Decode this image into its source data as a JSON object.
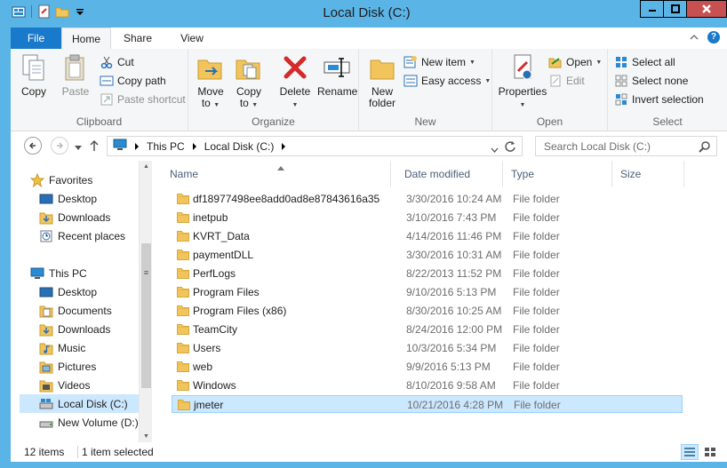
{
  "window": {
    "title": "Local Disk (C:)",
    "accent": "#5ab4e6"
  },
  "ribbon_tabs": {
    "file": "File",
    "home": "Home",
    "share": "Share",
    "view": "View"
  },
  "clipboard": {
    "label": "Clipboard",
    "copy": "Copy",
    "paste": "Paste",
    "cut": "Cut",
    "copy_path": "Copy path",
    "paste_shortcut": "Paste shortcut"
  },
  "organize": {
    "label": "Organize",
    "move_to": "Move",
    "move_to_2": "to",
    "copy_to": "Copy",
    "copy_to_2": "to",
    "delete": "Delete",
    "rename": "Rename"
  },
  "new_group": {
    "label": "New",
    "new_folder": "New",
    "new_folder_2": "folder",
    "new_item": "New item",
    "easy_access": "Easy access"
  },
  "open_group": {
    "label": "Open",
    "properties": "Properties",
    "open": "Open",
    "edit": "Edit"
  },
  "select_group": {
    "label": "Select",
    "select_all": "Select all",
    "select_none": "Select none",
    "invert_selection": "Invert selection"
  },
  "address": {
    "crumbs": [
      "This PC",
      "Local Disk (C:)"
    ],
    "search_placeholder": "Search Local Disk (C:)"
  },
  "nav": {
    "favorites": "Favorites",
    "fav_items": [
      "Desktop",
      "Downloads",
      "Recent places"
    ],
    "this_pc": "This PC",
    "pc_items": [
      "Desktop",
      "Documents",
      "Downloads",
      "Music",
      "Pictures",
      "Videos",
      "Local Disk (C:)",
      "New Volume (D:)"
    ]
  },
  "columns": {
    "name": "Name",
    "date": "Date modified",
    "type": "Type",
    "size": "Size"
  },
  "files": [
    {
      "name": "df18977498ee8add0ad8e87843616a35",
      "date": "3/30/2016 10:24 AM",
      "type": "File folder"
    },
    {
      "name": "inetpub",
      "date": "3/10/2016 7:43 PM",
      "type": "File folder"
    },
    {
      "name": "KVRT_Data",
      "date": "4/14/2016 11:46 PM",
      "type": "File folder"
    },
    {
      "name": "paymentDLL",
      "date": "3/30/2016 10:31 AM",
      "type": "File folder"
    },
    {
      "name": "PerfLogs",
      "date": "8/22/2013 11:52 PM",
      "type": "File folder"
    },
    {
      "name": "Program Files",
      "date": "9/10/2016 5:13 PM",
      "type": "File folder"
    },
    {
      "name": "Program Files (x86)",
      "date": "8/30/2016 10:25 AM",
      "type": "File folder"
    },
    {
      "name": "TeamCity",
      "date": "8/24/2016 12:00 PM",
      "type": "File folder"
    },
    {
      "name": "Users",
      "date": "10/3/2016 5:34 PM",
      "type": "File folder"
    },
    {
      "name": "web",
      "date": "9/9/2016 5:13 PM",
      "type": "File folder"
    },
    {
      "name": "Windows",
      "date": "8/10/2016 9:58 AM",
      "type": "File folder"
    },
    {
      "name": "jmeter",
      "date": "10/21/2016 4:28 PM",
      "type": "File folder"
    }
  ],
  "status": {
    "count": "12 items",
    "selected": "1 item selected"
  }
}
